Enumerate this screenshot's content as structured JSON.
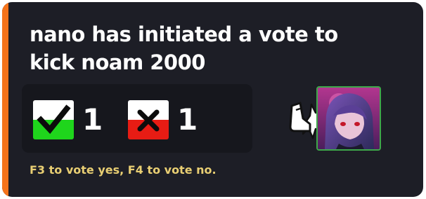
{
  "notification": {
    "title": "nano has initiated a vote to kick noam 2000",
    "hint": "F3 to vote yes, F4 to vote no.",
    "accent_color": "#f5731b"
  },
  "votes": {
    "yes": {
      "icon": "checkmark-icon",
      "count": "1",
      "color": "#1fd51c"
    },
    "no": {
      "icon": "x-mark-icon",
      "count": "1",
      "color": "#e71c14"
    }
  },
  "target": {
    "action_icon": "kick-icon",
    "avatar": "player-avatar"
  }
}
